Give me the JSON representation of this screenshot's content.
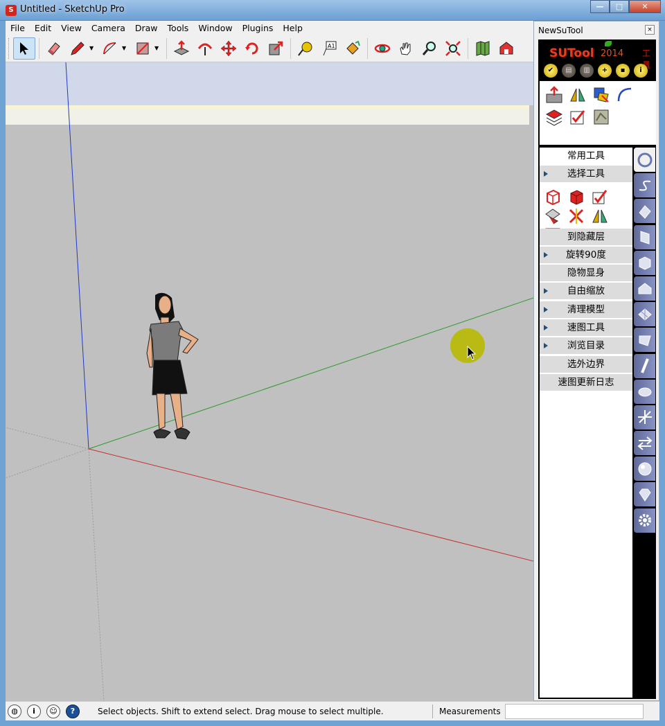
{
  "window": {
    "title": "Untitled - SketchUp Pro",
    "app_icon": "sketchup-icon",
    "controls": [
      "minimize-icon",
      "maximize-icon",
      "close-icon"
    ]
  },
  "menubar": {
    "items": [
      "File",
      "Edit",
      "View",
      "Camera",
      "Draw",
      "Tools",
      "Window",
      "Plugins",
      "Help"
    ]
  },
  "toolbar": {
    "tools": [
      "select-icon",
      "eraser-icon",
      "pencil-icon",
      "arc-icon",
      "rectangle-icon",
      "push-pull-icon",
      "follow-me-icon",
      "move-icon",
      "rotate-icon",
      "scale-icon",
      "tape-measure-icon",
      "text-icon",
      "paint-bucket-icon",
      "orbit-icon",
      "pan-icon",
      "zoom-icon",
      "zoom-extents-icon",
      "map-icon",
      "warehouse-icon"
    ]
  },
  "axes": {
    "blue": "#2038c8",
    "green": "#2a9a2a",
    "red": "#c83030",
    "dotted": "#9a9a9a"
  },
  "panel": {
    "title": "NewSuTool",
    "close": "×",
    "logo": "SUTool",
    "year": "2014",
    "logo_extra": "工具",
    "quick_buttons": [
      "check-icon",
      "clipboard-icon",
      "trash-icon",
      "plus-icon",
      "save-icon",
      "info-icon"
    ],
    "quick_glyphs": [
      "✔",
      "▤",
      "▥",
      "+",
      "▪",
      "i"
    ],
    "menu": [
      {
        "label": "常用工具",
        "arrow": false,
        "light": true
      },
      {
        "label": "选择工具",
        "arrow": true,
        "light": false
      },
      {
        "label": "到隐藏层",
        "arrow": false,
        "light": false
      },
      {
        "label": "旋转90度",
        "arrow": true,
        "light": false
      },
      {
        "label": "隐物显身",
        "arrow": false,
        "light": false
      },
      {
        "label": "自由缩放",
        "arrow": true,
        "light": false
      },
      {
        "label": "清理模型",
        "arrow": true,
        "light": false
      },
      {
        "label": "速图工具",
        "arrow": true,
        "light": false
      },
      {
        "label": "浏览目录",
        "arrow": true,
        "light": false
      },
      {
        "label": "选外边界",
        "arrow": false,
        "light": false
      },
      {
        "label": "速图更新日志",
        "arrow": false,
        "light": false
      }
    ]
  },
  "statusbar": {
    "message": "Select objects. Shift to extend select. Drag mouse to select multiple.",
    "measurements_label": "Measurements",
    "measurements_value": "",
    "icons": [
      "geolocation-icon",
      "credits-icon",
      "user-icon",
      "help-icon"
    ],
    "icon_glyphs": [
      "◍",
      "i",
      "☺",
      "?"
    ]
  }
}
